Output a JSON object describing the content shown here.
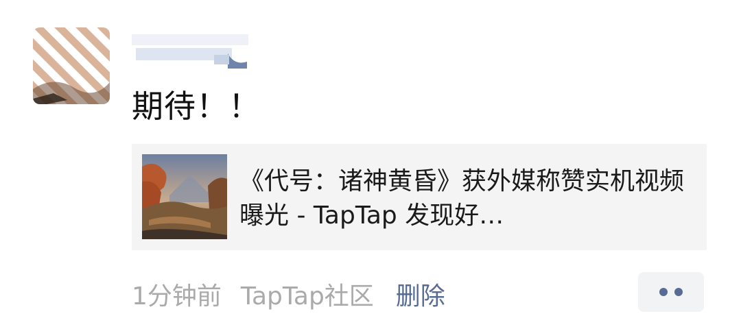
{
  "post": {
    "text": "期待！！",
    "card": {
      "title": "《代号：诸神黄昏》获外媒称赞实机视频曝光 - TapTap 发现好…"
    },
    "footer": {
      "time": "1分钟前",
      "source": "TapTap社区",
      "delete_label": "删除"
    }
  },
  "icons": {
    "more": "more-dots-icon"
  },
  "colors": {
    "link_blue": "#576b95",
    "meta_gray": "#aaaaaa",
    "card_bg": "#f4f4f4",
    "text_dark": "#111111"
  }
}
